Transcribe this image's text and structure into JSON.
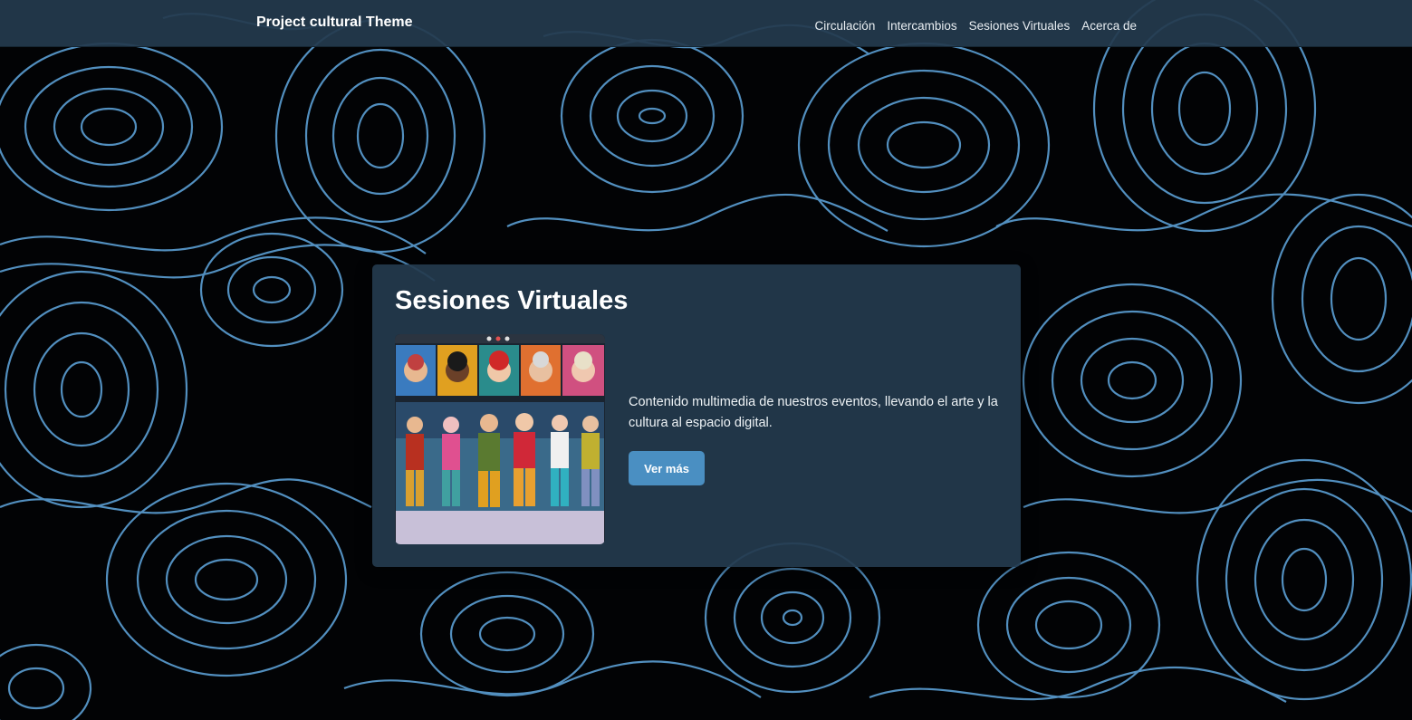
{
  "brand": {
    "name": "Project cultural Theme"
  },
  "nav": {
    "items": [
      {
        "label": "Circulación"
      },
      {
        "label": "Intercambios"
      },
      {
        "label": "Sesiones Virtuales"
      },
      {
        "label": "Acerca de"
      }
    ]
  },
  "section": {
    "title": "Sesiones Virtuales",
    "description": "Contenido multimedia de nuestros eventos, llevando el arte y la cultura al espacio digital.",
    "button_label": "Ver más",
    "image_icon": "video-call-collage-image"
  },
  "theme": {
    "navbar_color": "#233a4e",
    "card_color": "#233a4e",
    "accent_color": "#4a8fc2",
    "background_color": "#020305",
    "contour_color": "#5b9fd4"
  }
}
